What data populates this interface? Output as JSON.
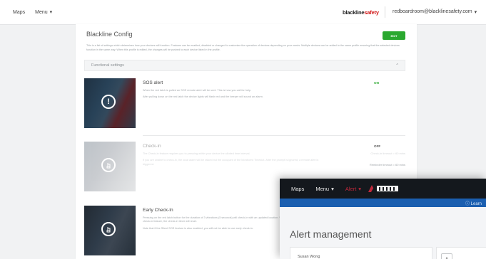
{
  "topbar": {
    "nav": [
      {
        "label": "Maps"
      },
      {
        "label": "Menu",
        "caret": "▾"
      }
    ],
    "brand_part1": "blackline",
    "brand_part2": "safety",
    "user_email": "redboardroom@blacklinesafety.com",
    "user_caret": "▾"
  },
  "config": {
    "title": "Blackline Config",
    "edit_label": "EDIT",
    "intro": "This is a list of settings which determines how your devices will function. Features can be enabled, disabled or changed to customize the operation of devices depending on your needs. Multiple devices can be added to the same profile ensuring that the selected devices function in the same way. When this profile is edited, the changes will be pushed to each device listed in the profile.",
    "section_label": "Functional settings",
    "section_caret": "^"
  },
  "settings": [
    {
      "title": "SOS alert",
      "status": "ON",
      "status_color": "#2aa82f",
      "desc1": "When the red latch is pulled an SOS remote alert will be sent. This is how you call for help.",
      "desc2": "After pulling down on the red latch the device lights will flash red and the beeper will sound an alarm.",
      "icon": "exclamation-icon"
    },
    {
      "title": "Check-in",
      "status": "OFF",
      "status_color": "#555555",
      "desc1": "The Check-in feature requires you to pressing within your device the allotted time interval.",
      "desc2": "If you are unable to check-in, the local alarm will be raised but the occupant of the Monitored Timeslot. After the prompt is ignored, a remote alert is triggered.",
      "meta1": "Check-in timeout = 60 mins",
      "meta2": "Reminder timeout = 60 mins",
      "icon": "touch-icon"
    },
    {
      "title": "Early Check-In",
      "desc1": "Pressing on the red latch button for the duration of 3 vibrations (5 seconds) will check-in with an updated location. When used in conjunction with the check-in feature, the check-in timer will reset.",
      "desc2": "Note that if the Silent SOS feature is also enabled, you will not be able to use early check-in.",
      "icon": "touch-icon"
    }
  ],
  "overlay": {
    "nav": [
      {
        "label": "Maps"
      },
      {
        "label": "Menu",
        "caret": "▾"
      },
      {
        "label": "Alert",
        "caret": "▾"
      }
    ],
    "learn_link": "ⓘ Learn",
    "title": "Alert management",
    "card_name": "Susan Wong",
    "map_label": "A"
  },
  "colors": {
    "accent_green": "#2aa82f",
    "alert_red": "#c0283b",
    "sub_blue": "#1b5fb0"
  }
}
